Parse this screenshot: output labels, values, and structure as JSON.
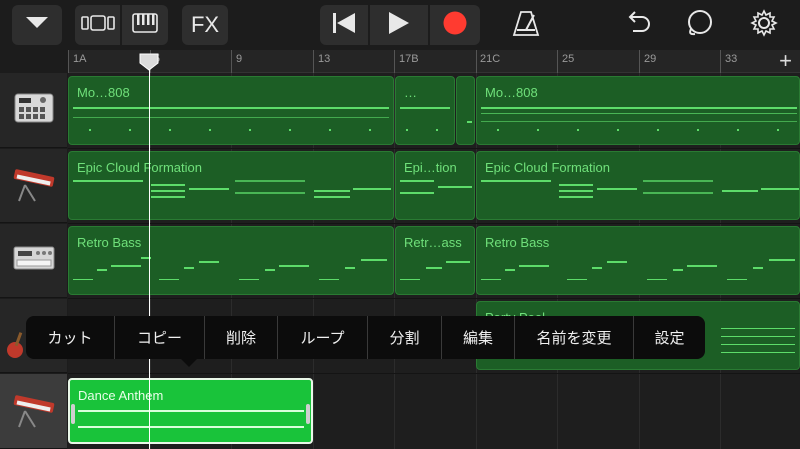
{
  "toolbar": {
    "fx_label": "FX",
    "colors": {
      "record": "#ff3b30",
      "background": "#1c1c1c",
      "button": "#2e2e2e"
    }
  },
  "ruler": {
    "labels": [
      "1A",
      "5",
      "9",
      "13",
      "17B",
      "21C",
      "25",
      "29",
      "33"
    ],
    "add_label": "+"
  },
  "tracks": [
    {
      "name": "drum-machine",
      "icon": "drum-machine-icon"
    },
    {
      "name": "keyboard",
      "icon": "keyboard-icon"
    },
    {
      "name": "synth-module",
      "icon": "synth-module-icon"
    },
    {
      "name": "guitar",
      "icon": "guitar-icon"
    },
    {
      "name": "keyboard",
      "icon": "keyboard-icon"
    }
  ],
  "regions": {
    "t1a": "Mo…808",
    "t1b": "…",
    "t1c": "Mo…808",
    "t2a": "Epic Cloud Formation",
    "t2b": "Epi…tion",
    "t2c": "Epic Cloud Formation",
    "t3a": "Retro Bass",
    "t3b": "Retr…ass",
    "t3c": "Retro Bass",
    "t4a": "Party Peel",
    "t5a": "Dance Anthem"
  },
  "context_menu": {
    "items": [
      "カット",
      "コピー",
      "削除",
      "ループ",
      "分割",
      "編集",
      "名前を変更",
      "設定"
    ]
  }
}
